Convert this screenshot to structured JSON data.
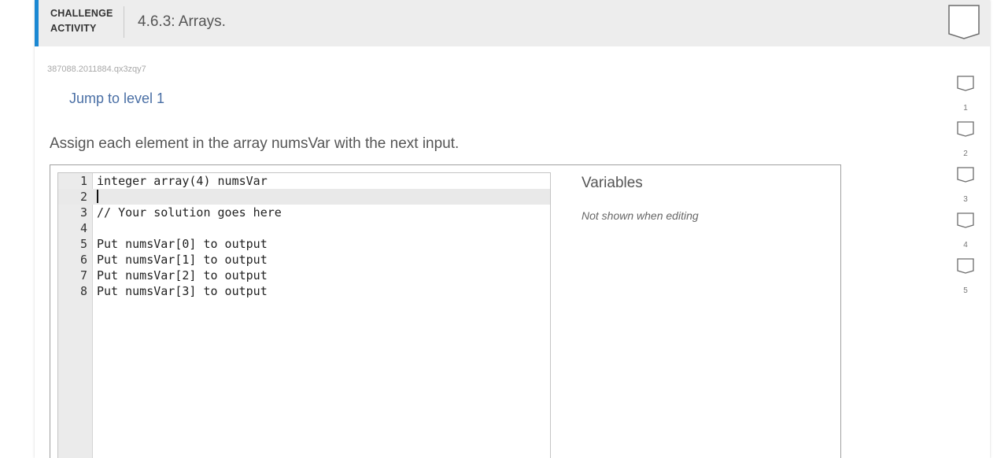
{
  "header": {
    "challenge_line1": "CHALLENGE",
    "challenge_line2": "ACTIVITY",
    "title": "4.6.3: Arrays."
  },
  "activity_id": "387088.2011884.qx3zqy7",
  "jump_link": "Jump to level 1",
  "instructions": "Assign each element in the array numsVar with the next input.",
  "editor": {
    "lines": [
      {
        "no": "1",
        "text": "integer array(4) numsVar"
      },
      {
        "no": "2",
        "text": ""
      },
      {
        "no": "3",
        "text": "// Your solution goes here"
      },
      {
        "no": "4",
        "text": ""
      },
      {
        "no": "5",
        "text": "Put numsVar[0] to output"
      },
      {
        "no": "6",
        "text": "Put numsVar[1] to output"
      },
      {
        "no": "7",
        "text": "Put numsVar[2] to output"
      },
      {
        "no": "8",
        "text": "Put numsVar[3] to output"
      }
    ],
    "active_line": 2
  },
  "variables": {
    "title": "Variables",
    "note": "Not shown when editing"
  },
  "levels": [
    "1",
    "2",
    "3",
    "4",
    "5"
  ],
  "colors": {
    "accent": "#1b88d3",
    "link": "#4a6fa5",
    "header_bg": "#ededed"
  }
}
